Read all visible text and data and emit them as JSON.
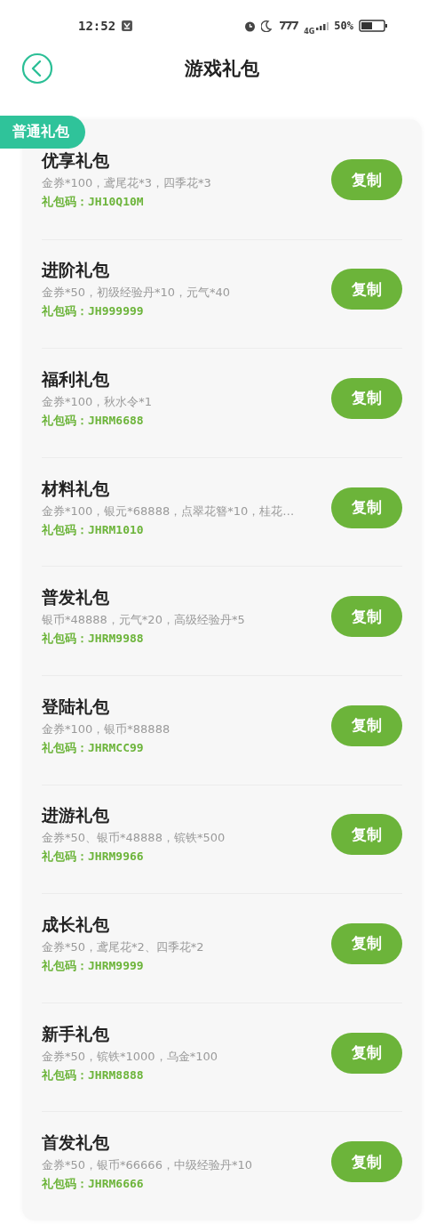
{
  "status_bar": {
    "time": "12:52",
    "network": "4G",
    "battery": "50%"
  },
  "header": {
    "title": "游戏礼包"
  },
  "section": {
    "label": "普通礼包"
  },
  "gifts": [
    {
      "name": "优享礼包",
      "contents": "金券*100，鸢尾花*3，四季花*3",
      "code": "礼包码：JH10Q10M",
      "button": "复制"
    },
    {
      "name": "进阶礼包",
      "contents": "金券*50，初级经验丹*10，元气*40",
      "code": "礼包码：JH999999",
      "button": "复制"
    },
    {
      "name": "福利礼包",
      "contents": "金券*100，秋水令*1",
      "code": "礼包码：JHRM6688",
      "button": "复制"
    },
    {
      "name": "材料礼包",
      "contents": "金券*100，银元*68888，点翠花簪*10，桂花…",
      "code": "礼包码：JHRM1010",
      "button": "复制"
    },
    {
      "name": "普发礼包",
      "contents": "银币*48888，元气*20，高级经验丹*5",
      "code": "礼包码：JHRM9988",
      "button": "复制"
    },
    {
      "name": "登陆礼包",
      "contents": "金券*100，银币*88888",
      "code": "礼包码：JHRMCC99",
      "button": "复制"
    },
    {
      "name": "进游礼包",
      "contents": "金券*50、银币*48888，镔铁*500",
      "code": "礼包码：JHRM9966",
      "button": "复制"
    },
    {
      "name": "成长礼包",
      "contents": "金券*50，鸢尾花*2、四季花*2",
      "code": "礼包码：JHRM9999",
      "button": "复制"
    },
    {
      "name": "新手礼包",
      "contents": "金券*50，镔铁*1000，乌金*100",
      "code": "礼包码：JHRM8888",
      "button": "复制"
    },
    {
      "name": "首发礼包",
      "contents": "金券*50，银币*66666，中级经验丹*10",
      "code": "礼包码：JHRM6666",
      "button": "复制"
    }
  ]
}
